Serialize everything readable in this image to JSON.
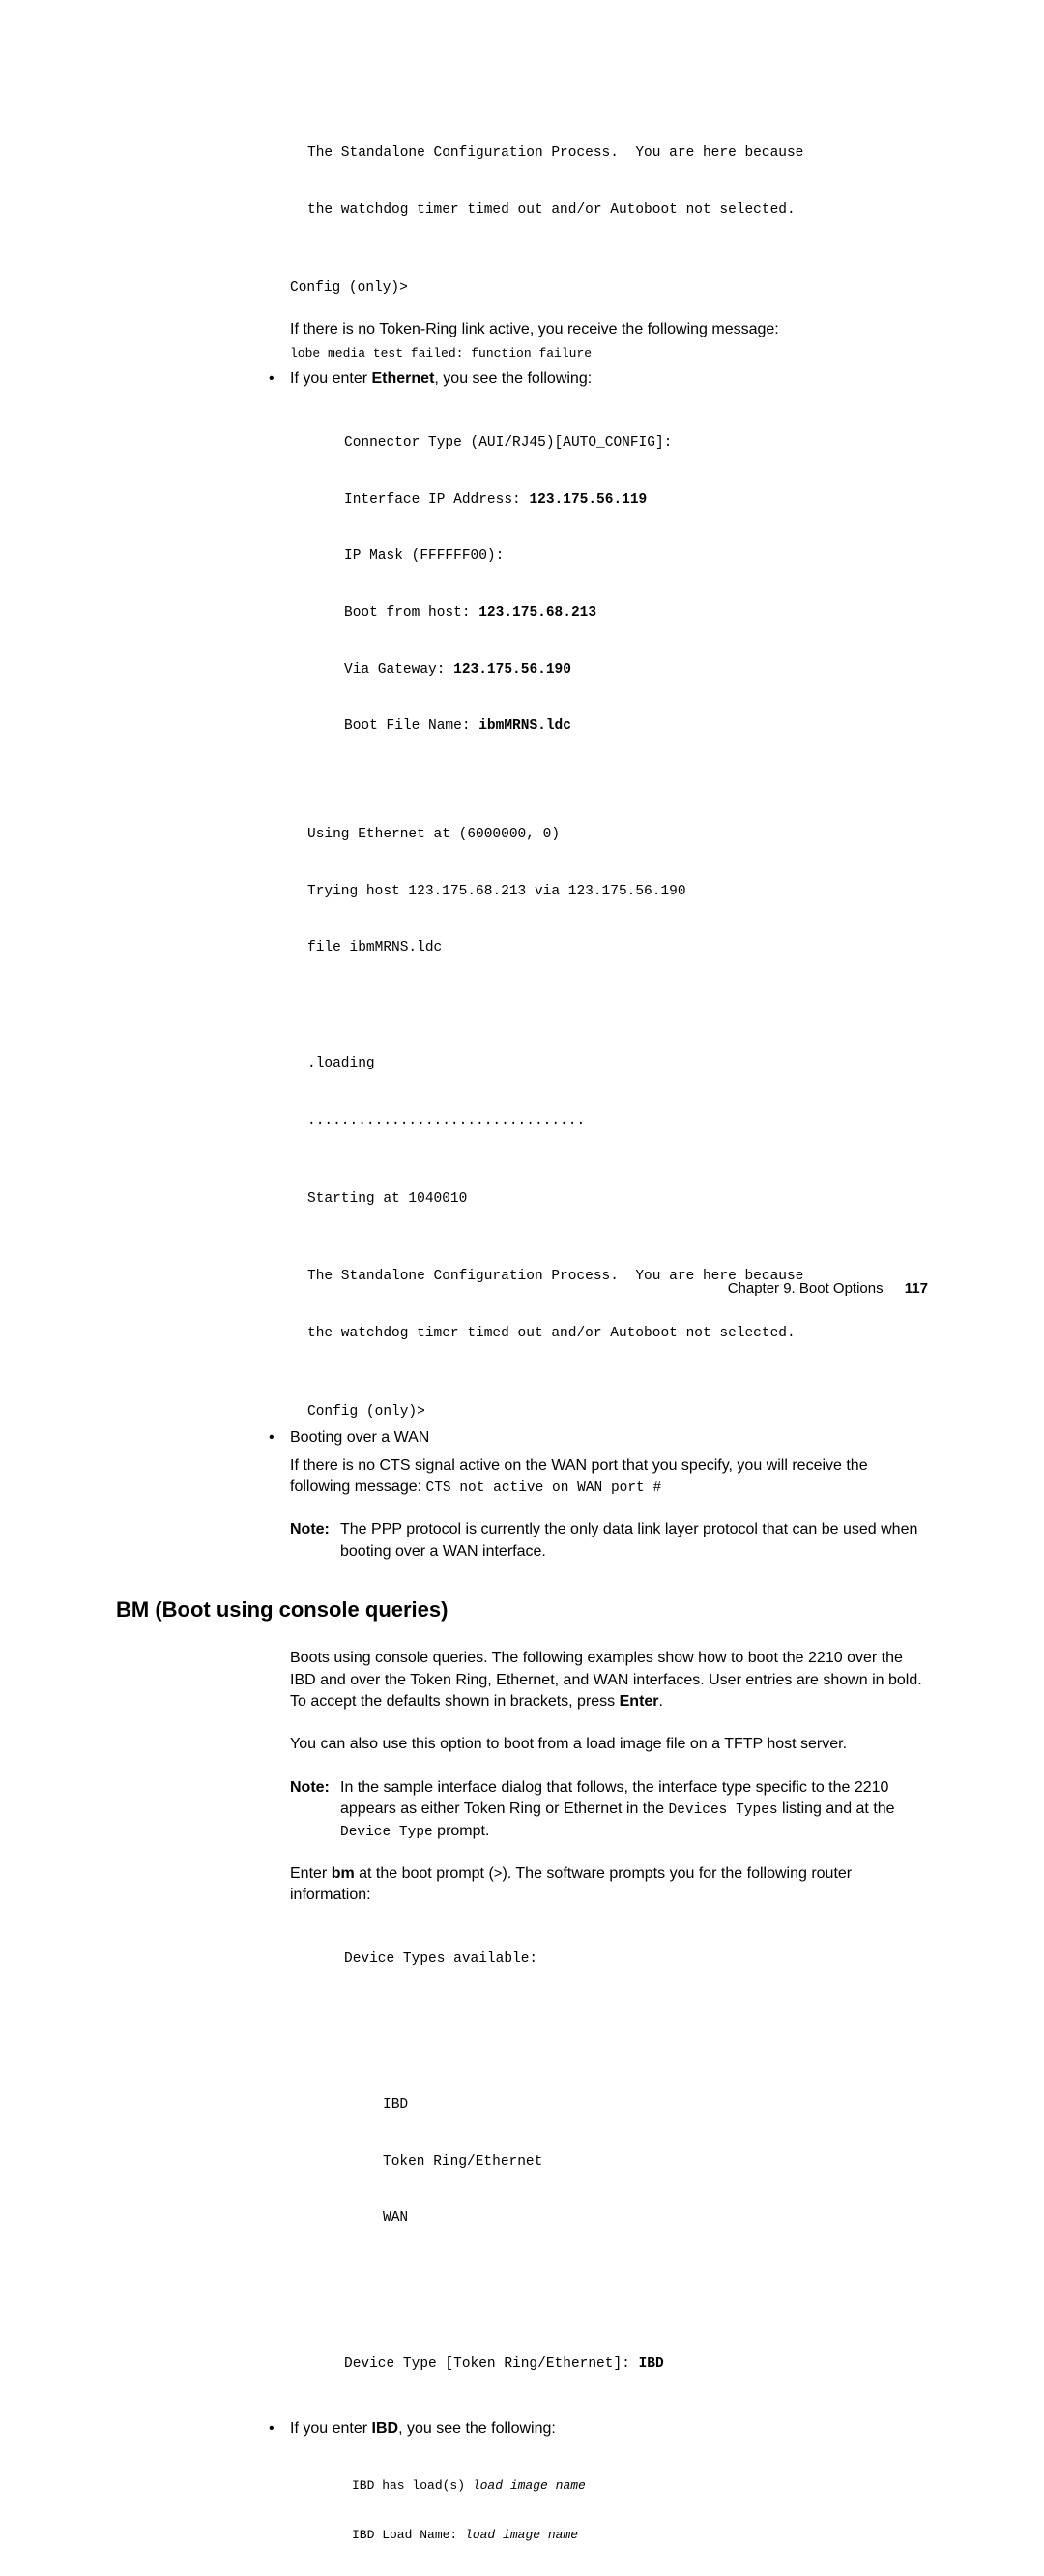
{
  "blk1": {
    "l1": "The Standalone Configuration Process.  You are here because",
    "l2": "the watchdog timer timed out and/or Autoboot not selected.",
    "l3": "Config (only)>"
  },
  "p1": "If there is no Token-Ring link active, you receive the following message:",
  "code1": "lobe media test failed: function failure",
  "bul1": {
    "pre": "If you enter ",
    "bold": "Ethernet",
    "post": ", you see the following:"
  },
  "eth": {
    "a": "Connector Type (AUI/RJ45)[AUTO_CONFIG]:",
    "b_pre": "Interface IP Address: ",
    "b_b": "123.175.56.119",
    "c": "IP Mask (FFFFFF00):",
    "d_pre": "Boot from host: ",
    "d_b": "123.175.68.213",
    "e_pre": "Via Gateway: ",
    "e_b": "123.175.56.190",
    "f_pre": "Boot File Name: ",
    "f_b": "ibmMRNS.ldc",
    "g": "Using Ethernet at (6000000, 0)",
    "h": "Trying host 123.175.68.213 via 123.175.56.190",
    "i": "file ibmMRNS.ldc",
    "j": ".loading",
    "k": ".................................",
    "l": "Starting at 1040010",
    "m": "The Standalone Configuration Process.  You are here because",
    "n": "the watchdog timer timed out and/or Autoboot not selected.",
    "o": "Config (only)>"
  },
  "bul2": "Booting over a WAN",
  "p2_pre": "If there is no CTS signal active on the WAN port that you specify, you will receive the following message: ",
  "p2_code": "CTS not active on WAN port #",
  "note1": {
    "label": "Note:",
    "body": "The PPP protocol is currently the only data link layer protocol that can be used when booting over a WAN interface."
  },
  "h2": "BM (Boot using console queries)",
  "p3_a": "Boots using console queries. The following examples show how to boot the 2210 over the IBD and over the Token Ring, Ethernet, and WAN interfaces. User entries are shown in bold. To accept the defaults shown in brackets, press ",
  "p3_b": "Enter",
  "p3_c": ".",
  "p4": "You can also use this option to boot from a load image file on a TFTP host server.",
  "note2": {
    "label": "Note:",
    "a": "In the sample interface dialog that follows, the interface type specific to the 2210 appears as either Token Ring or Ethernet in the ",
    "b": "Devices Types",
    "c": " listing and at the ",
    "d": "Device Type",
    "e": " prompt."
  },
  "p5_a": "Enter ",
  "p5_b": "bm",
  "p5_c": " at the boot prompt (",
  "p5_d": ">",
  "p5_e": "). The software prompts you for the following router information:",
  "dev": {
    "a": "Device Types available:",
    "b": "IBD",
    "c": "Token Ring/Ethernet",
    "d": "WAN",
    "e_pre": "Device Type [Token Ring/Ethernet]: ",
    "e_b": "IBD"
  },
  "bul3": {
    "pre": "If you enter ",
    "bold": "IBD",
    "post": ", you see the following:"
  },
  "ibd": {
    "a_pre": "IBD has load(s) ",
    "a_i": "load image name",
    "b_pre": "IBD Load Name: ",
    "b_i": "load image name"
  },
  "footer": {
    "chapter": "Chapter 9. Boot Options",
    "page": "117"
  }
}
